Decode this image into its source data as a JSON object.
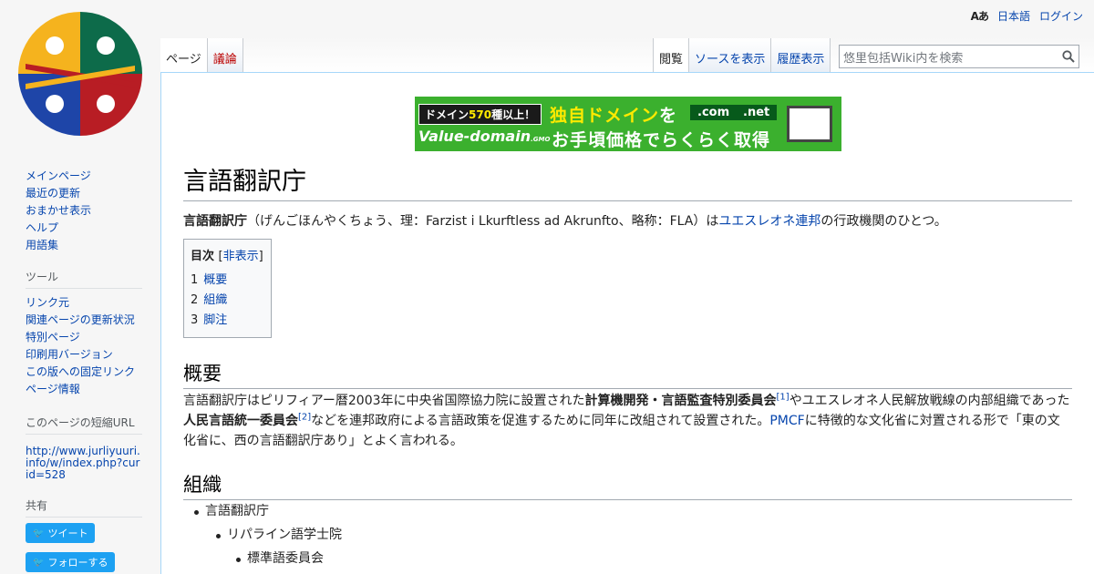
{
  "personal": {
    "lang_icon": "Aあ",
    "language": "日本語",
    "login": "ログイン"
  },
  "tabs_left": [
    {
      "label": "ページ",
      "selected": true
    },
    {
      "label": "議論",
      "new": true
    }
  ],
  "tabs_right": [
    {
      "label": "閲覧",
      "selected": true
    },
    {
      "label": "ソースを表示"
    },
    {
      "label": "履歴表示"
    }
  ],
  "search": {
    "placeholder": "悠里包括Wiki内を検索"
  },
  "sidebar": {
    "nav": [
      "メインページ",
      "最近の更新",
      "おまかせ表示",
      "ヘルプ",
      "用語集"
    ],
    "tools_heading": "ツール",
    "tools": [
      "リンク元",
      "関連ページの更新状況",
      "特別ページ",
      "印刷用バージョン",
      "この版への固定リンク",
      "ページ情報"
    ],
    "shorturl_heading": "このページの短縮URL",
    "shorturl": "http://www.jurliyuuri.info/w/index.php?curid=528",
    "share_heading": "共有",
    "tweet": "ツイート",
    "follow": "フォローする"
  },
  "banner": {
    "line1_a": "ドメイン",
    "line1_b": "570",
    "line1_c": "種以上！",
    "top_a": "独自ドメイン",
    "top_b": "を",
    "dom1": ".com",
    "dom2": ".net",
    "brand": "Value-domain",
    "brand_small": ".GMO",
    "bottom": "お手頃価格でらくらく取得"
  },
  "article": {
    "title": "言語翻訳庁",
    "lead_bold": "言語翻訳庁",
    "lead_1": "（げんごほんやくちょう、理：Farzist i Lkurftless ad Akrunfto、略称：FLA）は",
    "lead_link": "ユエスレオネ連邦",
    "lead_2": "の行政機関のひとつ。",
    "toc_title": "目次",
    "toc_toggle_open": "[",
    "toc_toggle": "非表示",
    "toc_toggle_close": "]",
    "toc": [
      {
        "num": "1",
        "text": "概要"
      },
      {
        "num": "2",
        "text": "組織"
      },
      {
        "num": "3",
        "text": "脚注"
      }
    ],
    "sec1": "概要",
    "p1_a": "言語翻訳庁はピリフィアー暦2003年に中央省国際協力院に設置された",
    "p1_b": "計算機開発・言語監査特別委員会",
    "p1_ref1": "[1]",
    "p1_c": "やユエスレオネ人民解放戦線の内部組織であった",
    "p1_d": "人民言語統一委員会",
    "p1_ref2": "[2]",
    "p1_e": "などを連邦政府による言語政策を促進するために同年に改組されて設置された。",
    "p1_link": "PMCF",
    "p1_f": "に特徴的な文化省に対置される形で「東の文化省に、西の言語翻訳庁あり」とよく言われる。",
    "sec2": "組織",
    "org": [
      "言語翻訳庁",
      "リパライン語学士院",
      "標準語委員会"
    ]
  }
}
